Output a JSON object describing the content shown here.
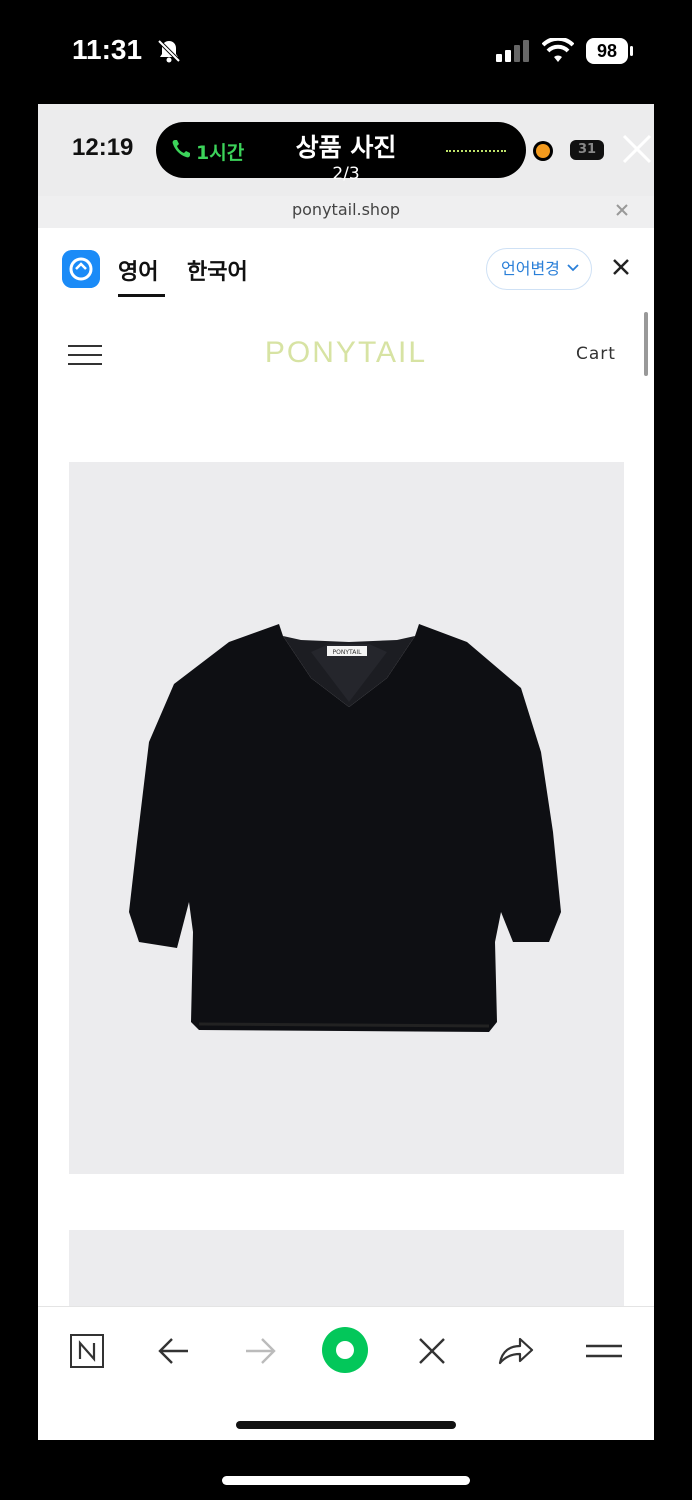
{
  "os_status": {
    "time": "11:31",
    "battery": "98"
  },
  "inner_status": {
    "time": "12:19",
    "call_duration": "1시간",
    "viewer_title": "상품 사진",
    "viewer_page": "2/3",
    "battery": "31"
  },
  "browser": {
    "url": "ponytail.shop"
  },
  "translate_bar": {
    "active_language": "영어",
    "other_language": "한국어",
    "change_language_label": "언어변경"
  },
  "site": {
    "logo": "PONYTAIL",
    "cart_label": "Cart"
  },
  "product": {
    "label_tag": "PONYTAIL",
    "garment": "black v-neck knit sweater"
  },
  "colors": {
    "logo": "#d7e3a3",
    "accent_blue": "#1b8bf7",
    "call_green": "#3cd35a",
    "naver_green": "#03c75a"
  },
  "toolbar_icons": [
    "naver-n-icon",
    "back-arrow-icon",
    "forward-arrow-icon",
    "green-dot-icon",
    "close-icon",
    "share-icon",
    "menu-icon"
  ]
}
